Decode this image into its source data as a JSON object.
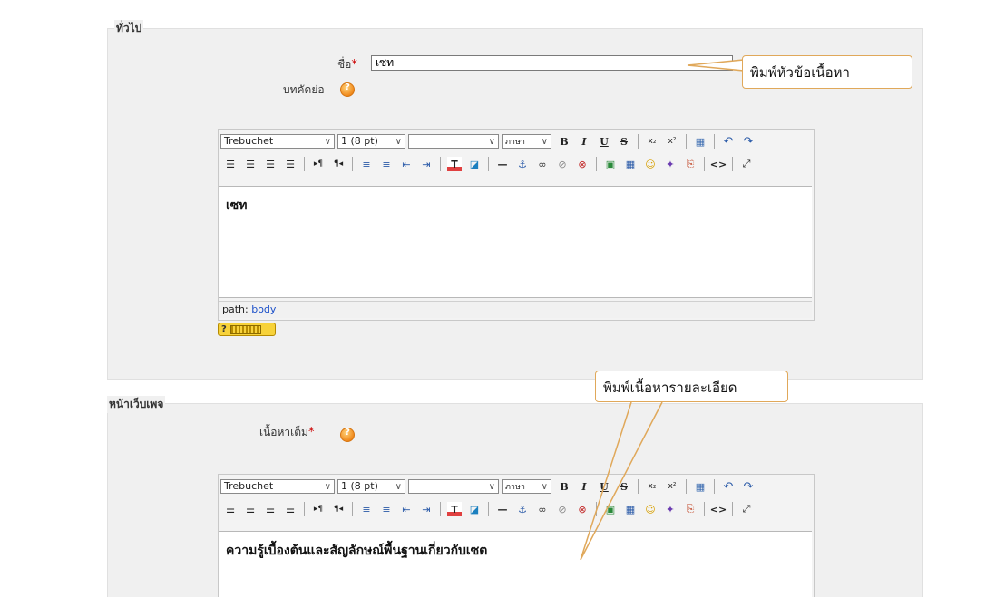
{
  "sections": {
    "general": {
      "legend": "ทั่วไป"
    },
    "webpage": {
      "legend": "หน้าเว็บเพจ"
    }
  },
  "name_field": {
    "label": "ชื่อ",
    "required_mark": "*",
    "value": "เซท"
  },
  "summary_field": {
    "label": "บทคัดย่อ"
  },
  "content_field": {
    "label": "เนื้อหาเต็ม",
    "required_mark": "*"
  },
  "editor1": {
    "font": "Trebuchet",
    "size": "1 (8 pt)",
    "heading": "",
    "lang": "ภาษา",
    "content": "เซท",
    "path_label": "path:",
    "path_value": "body",
    "keyboard_help": "?"
  },
  "editor2": {
    "font": "Trebuchet",
    "size": "1 (8 pt)",
    "heading": "",
    "lang": "ภาษา",
    "content": "ความรู้เบื้องต้นและสัญลักษณ์พื้นฐานเกี่ยวกับเซต"
  },
  "toolbar_row1_glyphs": {
    "bold": "B",
    "italic": "I",
    "underline": "U",
    "strike": "S",
    "subscript": "x₂",
    "superscript": "x²",
    "paste_word": "▦",
    "undo": "↶",
    "redo": "↷"
  },
  "toolbar_row2_glyphs": {
    "align_left": "☰",
    "align_center": "☰",
    "align_right": "☰",
    "justify": "☰",
    "ltr": "▸¶",
    "rtl": "¶◂",
    "ordered_list": "≡",
    "unordered_list": "≡",
    "outdent": "⇤",
    "indent": "⇥",
    "text_color": "T",
    "bg_color": "◪",
    "hr": "—",
    "anchor": "⚓",
    "link": "∞",
    "unlink": "⊘",
    "nolink": "⊗",
    "image": "▣",
    "table": "▦",
    "smiley": "☺",
    "special": "✦",
    "paste_text": "⎘",
    "html_source": "<>",
    "fullscreen": "⤢"
  },
  "callouts": {
    "title_hint": "พิมพ์หัวข้อเนื้อหา",
    "detail_hint": "พิมพ์เนื้อหารายละเอียด"
  },
  "colors": {
    "callout_border": "#e0a85a",
    "required": "#cc0000",
    "path_link": "#1a4fc9"
  }
}
